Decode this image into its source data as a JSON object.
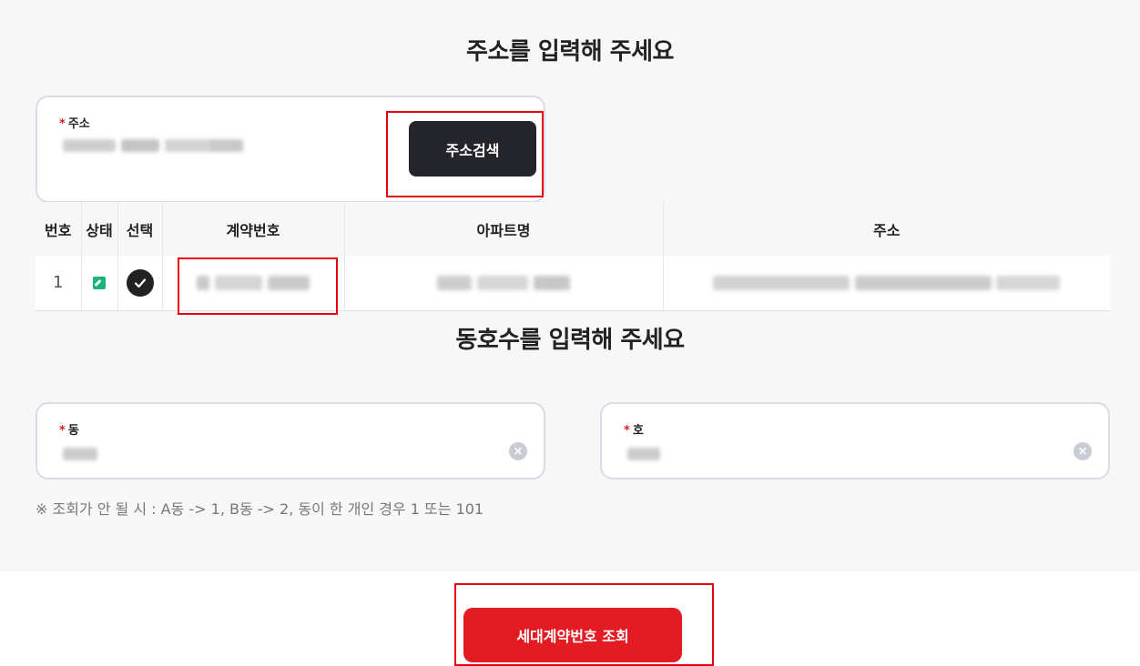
{
  "address_section": {
    "title": "주소를 입력해 주세요",
    "required_mark": "*",
    "field_label": "주소",
    "search_button": "주소검색"
  },
  "table": {
    "headers": [
      "번호",
      "상태",
      "선택",
      "계약번호",
      "아파트명",
      "주소"
    ],
    "rows": [
      {
        "number": "1"
      }
    ]
  },
  "unit_section": {
    "title": "동호수를 입력해 주세요",
    "required_mark": "*",
    "dong_label": "동",
    "ho_label": "호",
    "clear_icon": "×",
    "note": "※ 조회가 안 될 시 : A동 -> 1, B동 -> 2, 동이 한 개인 경우 1 또는 101"
  },
  "submit_button": "세대계약번호 조회",
  "colors": {
    "accent_red": "#e31c23",
    "dark_button": "#24262b",
    "status_green": "#19b47a",
    "highlight_red": "#e60012"
  }
}
